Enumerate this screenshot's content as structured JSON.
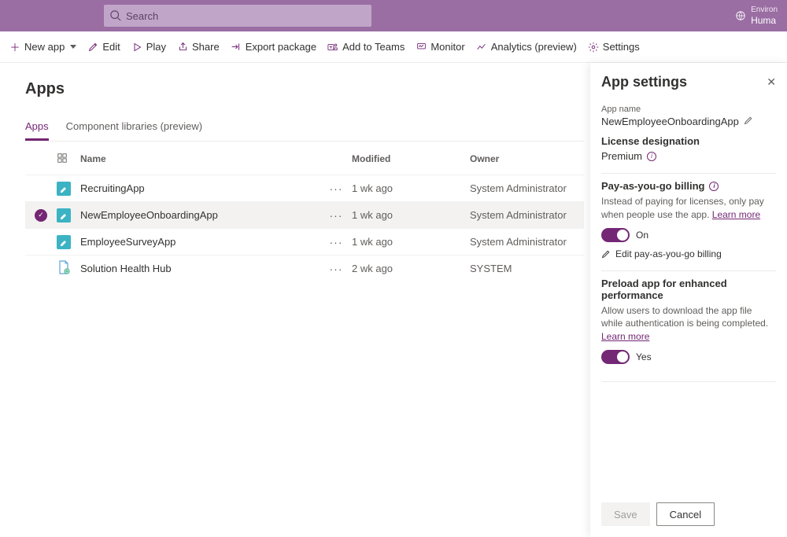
{
  "topbar": {
    "search_placeholder": "Search",
    "env_label1": "Environ",
    "env_label2": "Huma"
  },
  "cmdbar": {
    "new_app": "New app",
    "edit": "Edit",
    "play": "Play",
    "share": "Share",
    "export": "Export package",
    "add_teams": "Add to Teams",
    "monitor": "Monitor",
    "analytics": "Analytics (preview)",
    "settings": "Settings"
  },
  "page_title": "Apps",
  "tabs": {
    "apps": "Apps",
    "libs": "Component libraries (preview)"
  },
  "cols": {
    "name": "Name",
    "modified": "Modified",
    "owner": "Owner"
  },
  "rows": [
    {
      "name": "RecruitingApp",
      "modified": "1 wk ago",
      "owner": "System Administrator",
      "selected": false,
      "icon": "canvas-teal"
    },
    {
      "name": "NewEmployeeOnboardingApp",
      "modified": "1 wk ago",
      "owner": "System Administrator",
      "selected": true,
      "icon": "canvas-teal"
    },
    {
      "name": "EmployeeSurveyApp",
      "modified": "1 wk ago",
      "owner": "System Administrator",
      "selected": false,
      "icon": "canvas-teal"
    },
    {
      "name": "Solution Health Hub",
      "modified": "2 wk ago",
      "owner": "SYSTEM",
      "selected": false,
      "icon": "model-doc"
    }
  ],
  "panel": {
    "title": "App settings",
    "app_name_label": "App name",
    "app_name_value": "NewEmployeeOnboardingApp",
    "license_label": "License designation",
    "license_value": "Premium",
    "payg_title": "Pay-as-you-go billing",
    "payg_desc": "Instead of paying for licenses, only pay when people use the app. ",
    "payg_learn": "Learn more",
    "payg_toggle": "On",
    "payg_edit": "Edit pay-as-you-go billing",
    "preload_title": "Preload app for enhanced performance",
    "preload_desc": "Allow users to download the app file while authentication is being completed. ",
    "preload_learn": "Learn more",
    "preload_toggle": "Yes",
    "save": "Save",
    "cancel": "Cancel"
  }
}
